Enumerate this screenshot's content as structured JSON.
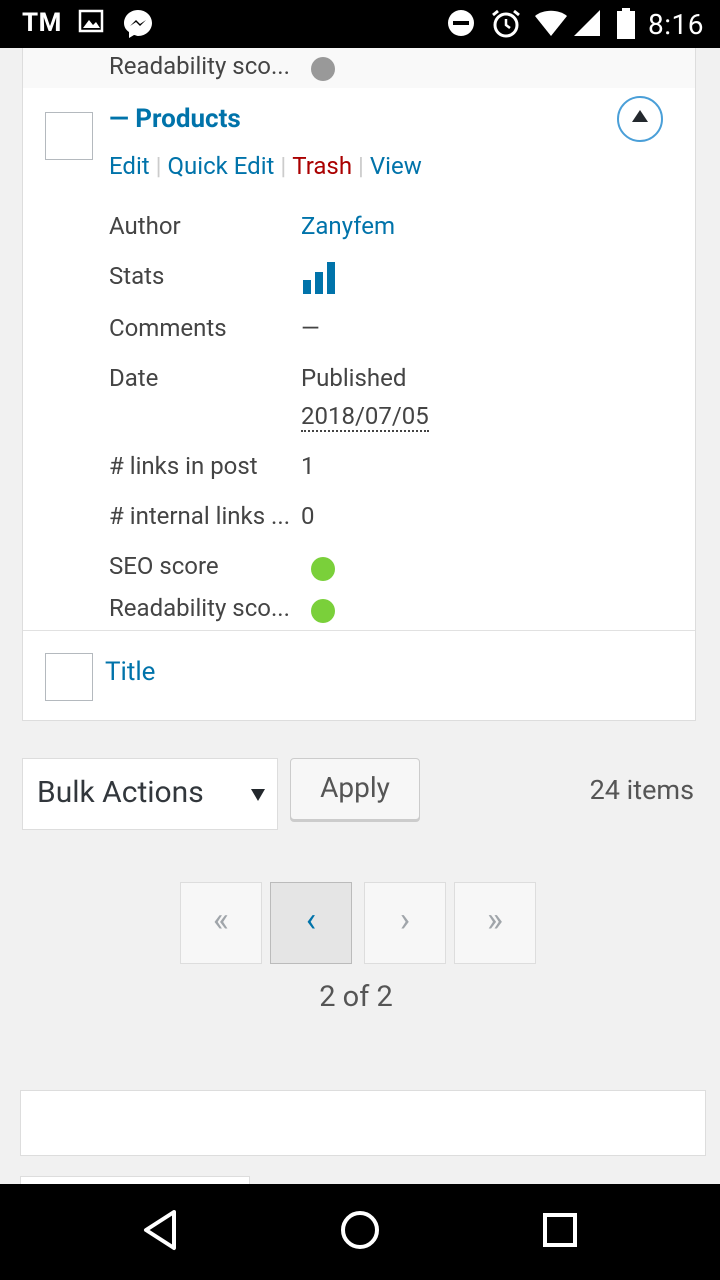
{
  "status_bar": {
    "carrier": "TM",
    "time": "8:16",
    "icons": [
      "image-icon",
      "messenger-icon",
      "do-not-disturb-icon",
      "alarm-icon",
      "wifi-icon",
      "signal-icon",
      "battery-icon"
    ]
  },
  "previous_row": {
    "readability_label": "Readability sco...",
    "readability_status": "gray"
  },
  "post": {
    "title": "— Products",
    "actions": {
      "edit": "Edit",
      "quick_edit": "Quick Edit",
      "trash": "Trash",
      "view": "View"
    },
    "fields": {
      "author_label": "Author",
      "author_value": "Zanyfem",
      "stats_label": "Stats",
      "comments_label": "Comments",
      "comments_value": "—",
      "date_label": "Date",
      "date_status": "Published",
      "date_value": "2018/07/05",
      "links_label": "# links in post",
      "links_value": "1",
      "internal_links_label": "# internal links ...",
      "internal_links_value": "0",
      "seo_label": "SEO score",
      "seo_status": "green",
      "readability_label": "Readability sco...",
      "readability_status": "green"
    }
  },
  "title_row": {
    "label": "Title"
  },
  "bulk": {
    "select_value": "Bulk Actions",
    "apply_label": "Apply",
    "items_count": "24 items"
  },
  "pagination": {
    "first": "«",
    "prev": "‹",
    "next": "›",
    "last": "»",
    "info": "2 of 2"
  },
  "colors": {
    "link": "#0073aa",
    "trash": "#aa0000",
    "status_green": "#7ad03a",
    "status_gray": "#999999"
  }
}
